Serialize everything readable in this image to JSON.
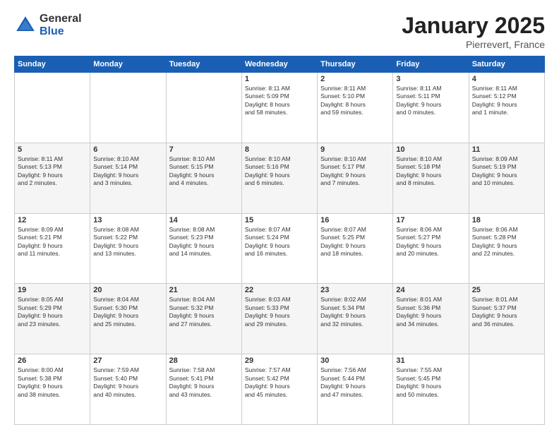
{
  "logo": {
    "general": "General",
    "blue": "Blue"
  },
  "title": {
    "month": "January 2025",
    "location": "Pierrevert, France"
  },
  "weekdays": [
    "Sunday",
    "Monday",
    "Tuesday",
    "Wednesday",
    "Thursday",
    "Friday",
    "Saturday"
  ],
  "weeks": [
    [
      {
        "day": "",
        "info": ""
      },
      {
        "day": "",
        "info": ""
      },
      {
        "day": "",
        "info": ""
      },
      {
        "day": "1",
        "info": "Sunrise: 8:11 AM\nSunset: 5:09 PM\nDaylight: 8 hours\nand 58 minutes."
      },
      {
        "day": "2",
        "info": "Sunrise: 8:11 AM\nSunset: 5:10 PM\nDaylight: 8 hours\nand 59 minutes."
      },
      {
        "day": "3",
        "info": "Sunrise: 8:11 AM\nSunset: 5:11 PM\nDaylight: 9 hours\nand 0 minutes."
      },
      {
        "day": "4",
        "info": "Sunrise: 8:11 AM\nSunset: 5:12 PM\nDaylight: 9 hours\nand 1 minute."
      }
    ],
    [
      {
        "day": "5",
        "info": "Sunrise: 8:11 AM\nSunset: 5:13 PM\nDaylight: 9 hours\nand 2 minutes."
      },
      {
        "day": "6",
        "info": "Sunrise: 8:10 AM\nSunset: 5:14 PM\nDaylight: 9 hours\nand 3 minutes."
      },
      {
        "day": "7",
        "info": "Sunrise: 8:10 AM\nSunset: 5:15 PM\nDaylight: 9 hours\nand 4 minutes."
      },
      {
        "day": "8",
        "info": "Sunrise: 8:10 AM\nSunset: 5:16 PM\nDaylight: 9 hours\nand 6 minutes."
      },
      {
        "day": "9",
        "info": "Sunrise: 8:10 AM\nSunset: 5:17 PM\nDaylight: 9 hours\nand 7 minutes."
      },
      {
        "day": "10",
        "info": "Sunrise: 8:10 AM\nSunset: 5:18 PM\nDaylight: 9 hours\nand 8 minutes."
      },
      {
        "day": "11",
        "info": "Sunrise: 8:09 AM\nSunset: 5:19 PM\nDaylight: 9 hours\nand 10 minutes."
      }
    ],
    [
      {
        "day": "12",
        "info": "Sunrise: 8:09 AM\nSunset: 5:21 PM\nDaylight: 9 hours\nand 11 minutes."
      },
      {
        "day": "13",
        "info": "Sunrise: 8:08 AM\nSunset: 5:22 PM\nDaylight: 9 hours\nand 13 minutes."
      },
      {
        "day": "14",
        "info": "Sunrise: 8:08 AM\nSunset: 5:23 PM\nDaylight: 9 hours\nand 14 minutes."
      },
      {
        "day": "15",
        "info": "Sunrise: 8:07 AM\nSunset: 5:24 PM\nDaylight: 9 hours\nand 16 minutes."
      },
      {
        "day": "16",
        "info": "Sunrise: 8:07 AM\nSunset: 5:25 PM\nDaylight: 9 hours\nand 18 minutes."
      },
      {
        "day": "17",
        "info": "Sunrise: 8:06 AM\nSunset: 5:27 PM\nDaylight: 9 hours\nand 20 minutes."
      },
      {
        "day": "18",
        "info": "Sunrise: 8:06 AM\nSunset: 5:28 PM\nDaylight: 9 hours\nand 22 minutes."
      }
    ],
    [
      {
        "day": "19",
        "info": "Sunrise: 8:05 AM\nSunset: 5:29 PM\nDaylight: 9 hours\nand 23 minutes."
      },
      {
        "day": "20",
        "info": "Sunrise: 8:04 AM\nSunset: 5:30 PM\nDaylight: 9 hours\nand 25 minutes."
      },
      {
        "day": "21",
        "info": "Sunrise: 8:04 AM\nSunset: 5:32 PM\nDaylight: 9 hours\nand 27 minutes."
      },
      {
        "day": "22",
        "info": "Sunrise: 8:03 AM\nSunset: 5:33 PM\nDaylight: 9 hours\nand 29 minutes."
      },
      {
        "day": "23",
        "info": "Sunrise: 8:02 AM\nSunset: 5:34 PM\nDaylight: 9 hours\nand 32 minutes."
      },
      {
        "day": "24",
        "info": "Sunrise: 8:01 AM\nSunset: 5:36 PM\nDaylight: 9 hours\nand 34 minutes."
      },
      {
        "day": "25",
        "info": "Sunrise: 8:01 AM\nSunset: 5:37 PM\nDaylight: 9 hours\nand 36 minutes."
      }
    ],
    [
      {
        "day": "26",
        "info": "Sunrise: 8:00 AM\nSunset: 5:38 PM\nDaylight: 9 hours\nand 38 minutes."
      },
      {
        "day": "27",
        "info": "Sunrise: 7:59 AM\nSunset: 5:40 PM\nDaylight: 9 hours\nand 40 minutes."
      },
      {
        "day": "28",
        "info": "Sunrise: 7:58 AM\nSunset: 5:41 PM\nDaylight: 9 hours\nand 43 minutes."
      },
      {
        "day": "29",
        "info": "Sunrise: 7:57 AM\nSunset: 5:42 PM\nDaylight: 9 hours\nand 45 minutes."
      },
      {
        "day": "30",
        "info": "Sunrise: 7:56 AM\nSunset: 5:44 PM\nDaylight: 9 hours\nand 47 minutes."
      },
      {
        "day": "31",
        "info": "Sunrise: 7:55 AM\nSunset: 5:45 PM\nDaylight: 9 hours\nand 50 minutes."
      },
      {
        "day": "",
        "info": ""
      }
    ]
  ]
}
